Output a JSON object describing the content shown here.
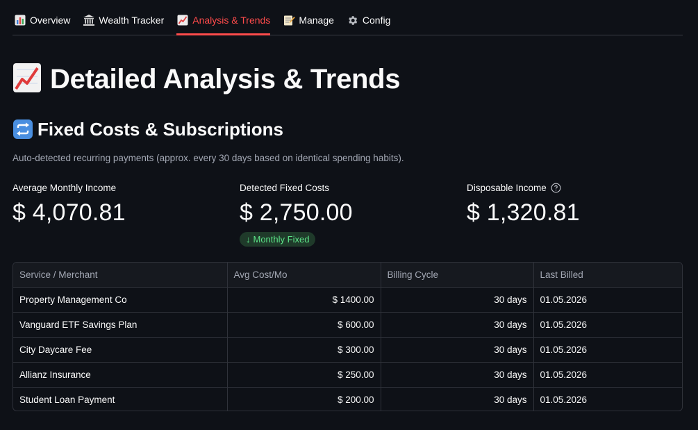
{
  "tabs": [
    {
      "label": "Overview",
      "icon": "bar-chart-icon",
      "active": false
    },
    {
      "label": "Wealth Tracker",
      "icon": "bank-icon",
      "active": false
    },
    {
      "label": "Analysis & Trends",
      "icon": "trend-up-chart-icon",
      "active": true
    },
    {
      "label": "Manage",
      "icon": "memo-icon",
      "active": false
    },
    {
      "label": "Config",
      "icon": "gear-icon",
      "active": false
    }
  ],
  "page": {
    "title": "Detailed Analysis & Trends",
    "section_title": "Fixed Costs & Subscriptions",
    "caption": "Auto-detected recurring payments (approx. every 30 days based on identical spending habits)."
  },
  "metrics": [
    {
      "label": "Average Monthly Income",
      "value": "$ 4,070.81"
    },
    {
      "label": "Detected Fixed Costs",
      "value": "$ 2,750.00",
      "delta": "Monthly Fixed"
    },
    {
      "label": "Disposable Income",
      "value": "$ 1,320.81"
    }
  ],
  "table": {
    "columns": [
      "Service / Merchant",
      "Avg Cost/Mo",
      "Billing Cycle",
      "Last Billed"
    ],
    "rows": [
      [
        "Property Management Co",
        "$ 1400.00",
        "30 days",
        "01.05.2026"
      ],
      [
        "Vanguard ETF Savings Plan",
        "$ 600.00",
        "30 days",
        "01.05.2026"
      ],
      [
        "City Daycare Fee",
        "$ 300.00",
        "30 days",
        "01.05.2026"
      ],
      [
        "Allianz Insurance",
        "$ 250.00",
        "30 days",
        "01.05.2026"
      ],
      [
        "Student Loan Payment",
        "$ 200.00",
        "30 days",
        "01.05.2026"
      ]
    ]
  },
  "colors": {
    "background": "#0e1117",
    "accent": "#ff4b4b",
    "delta_positive": "#5ce488"
  }
}
